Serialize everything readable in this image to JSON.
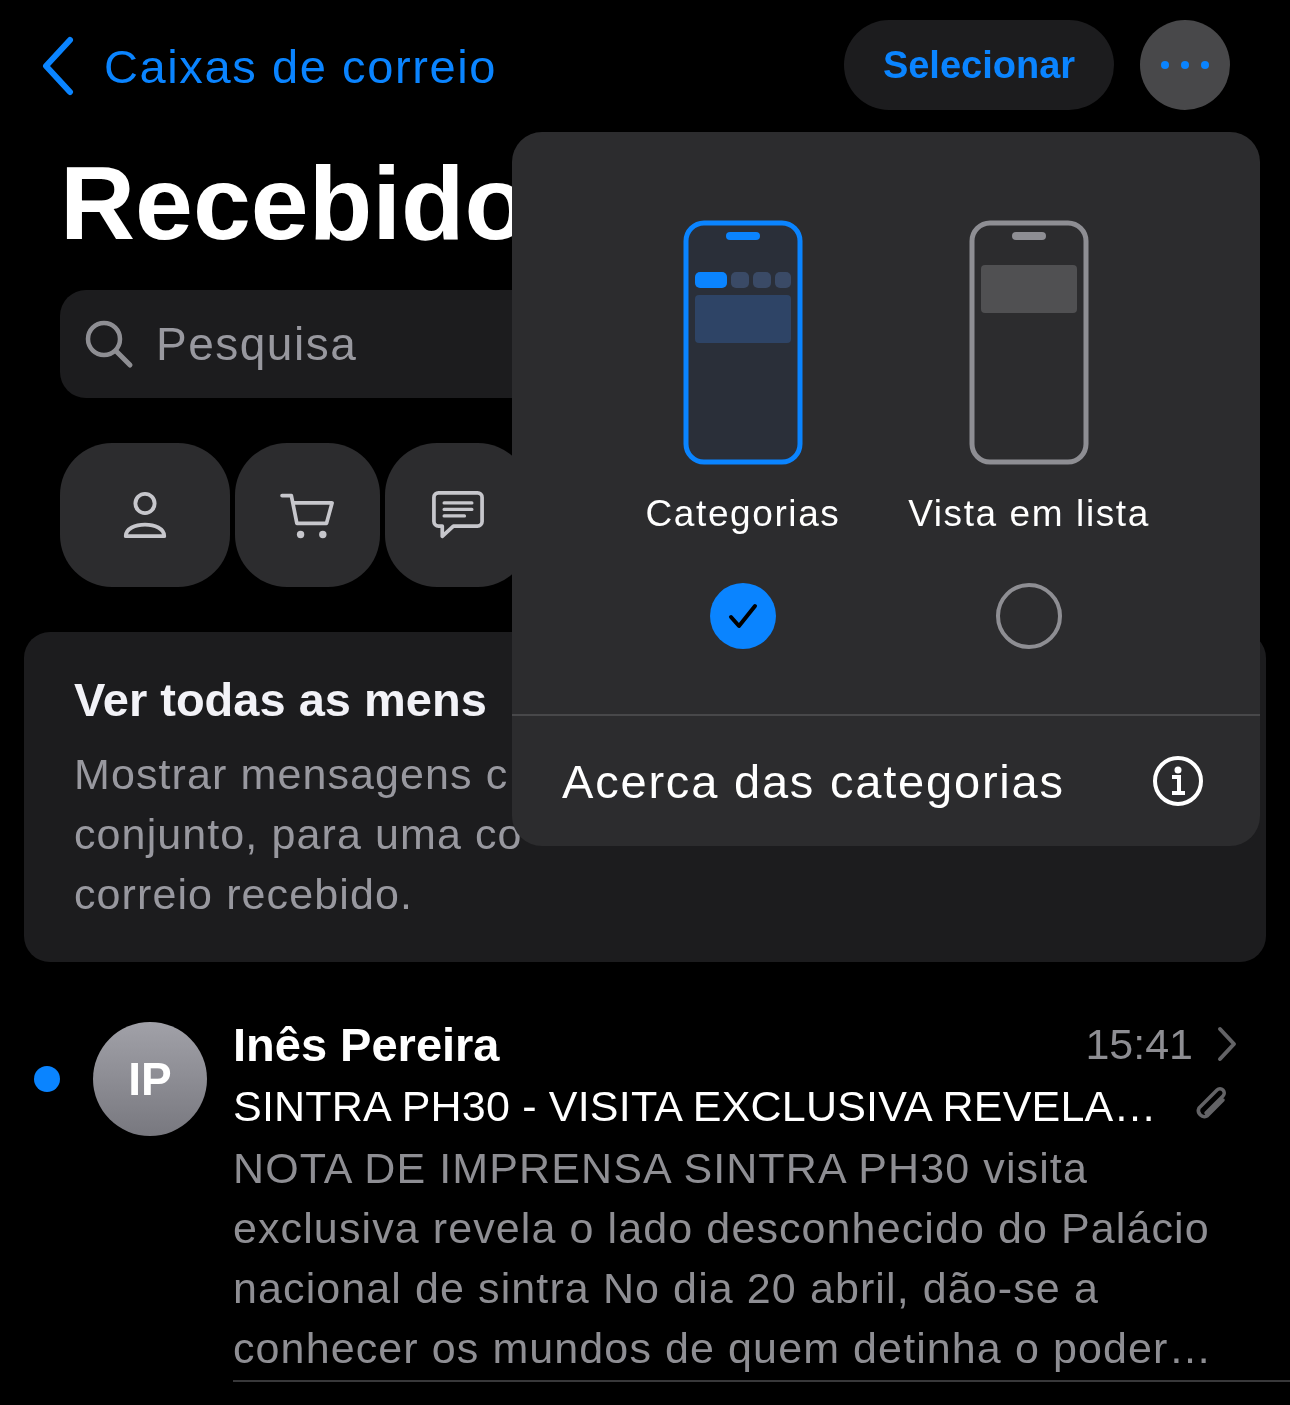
{
  "nav": {
    "back_label": "Caixas de correio",
    "select_button": "Selecionar"
  },
  "title": "Recebido",
  "search": {
    "placeholder": "Pesquisa"
  },
  "info_card": {
    "title": "Ver todas as mens",
    "lines": [
      "Mostrar mensagens c",
      "conjunto, para uma co",
      "correio recebido."
    ]
  },
  "view_menu": {
    "options": [
      {
        "label": "Categorias",
        "kind": "categories",
        "selected": true
      },
      {
        "label": "Vista em lista",
        "kind": "list",
        "selected": false
      }
    ],
    "about": "Acerca das categorias"
  },
  "messages": [
    {
      "sender": "Inês Pereira",
      "initials": "IP",
      "unread": true,
      "time": "15:41",
      "subject": "SINTRA PH30 - VISITA EXCLUSIVA REVELA…",
      "has_attachment": true,
      "preview": "NOTA DE IMPRENSA SINTRA PH30 visita exclusiva revela o lado desconhecido do Palácio nacional de sintra No dia 20 abril, dão-se a conhecer os mundos de quem detinha o poder…"
    }
  ]
}
